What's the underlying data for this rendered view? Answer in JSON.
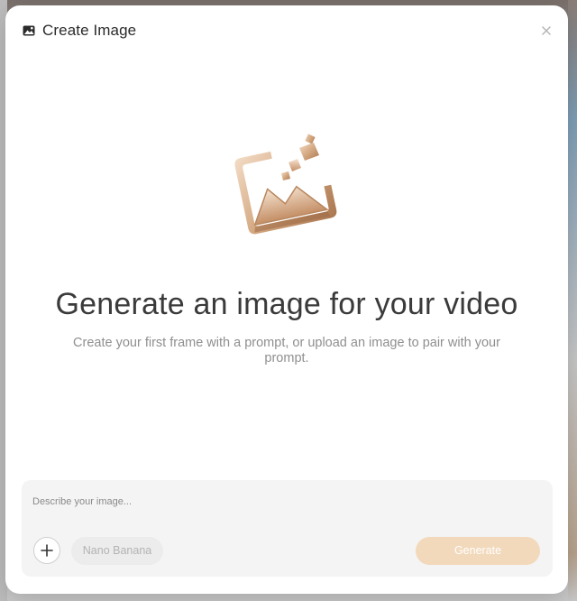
{
  "modal": {
    "title": "Create Image",
    "header_icon": "image-icon",
    "close_icon": "close-icon"
  },
  "hero": {
    "illustration": "image-illustration",
    "title": "Generate an image for your video",
    "subtitle": "Create your first frame with a prompt, or upload an image to pair with your prompt."
  },
  "prompt": {
    "placeholder": "Describe your image...",
    "value": "",
    "add_icon": "plus-icon",
    "model_label": "Nano Banana",
    "generate_label": "Generate"
  },
  "colors": {
    "accent_disabled": "#f2d9bb",
    "panel_background": "#f4f4f4"
  }
}
